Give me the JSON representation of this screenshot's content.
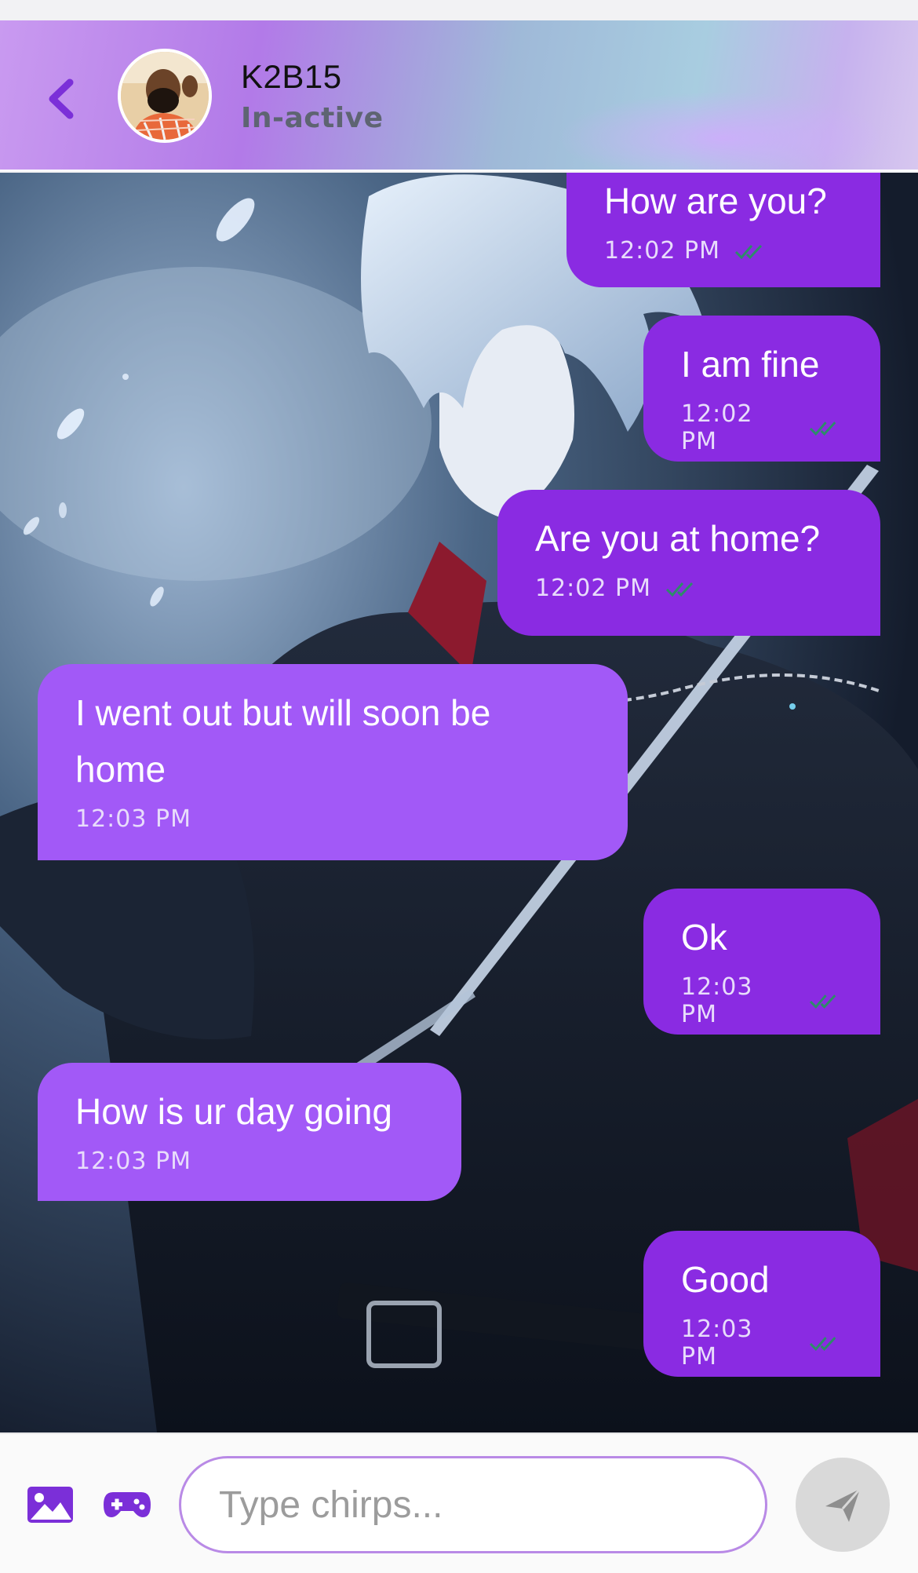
{
  "header": {
    "contact_name": "K2B15",
    "contact_status": "In-active",
    "accent": "#7b2fd8"
  },
  "messages": [
    {
      "direction": "out",
      "text": "How are you?",
      "time": "12:02 PM",
      "read": true
    },
    {
      "direction": "out",
      "text": "I am fine",
      "time": "12:02 PM",
      "read": true
    },
    {
      "direction": "out",
      "text": "Are you at home?",
      "time": "12:02 PM",
      "read": true
    },
    {
      "direction": "in",
      "text": "I went out but will soon be home",
      "time": "12:03 PM"
    },
    {
      "direction": "out",
      "text": "Ok",
      "time": "12:03 PM",
      "read": true
    },
    {
      "direction": "in",
      "text": "How is ur day going",
      "time": "12:03 PM"
    },
    {
      "direction": "out",
      "text": "Good",
      "time": "12:03 PM",
      "read": true
    }
  ],
  "composer": {
    "placeholder": "Type chirps...",
    "image_icon": "image-icon",
    "game_icon": "gamepad-icon",
    "send_icon": "send-icon"
  },
  "colors": {
    "outgoing_bubble": "#8a2be2",
    "incoming_bubble": "#a259f7",
    "read_ticks": "#2e8b6a"
  }
}
